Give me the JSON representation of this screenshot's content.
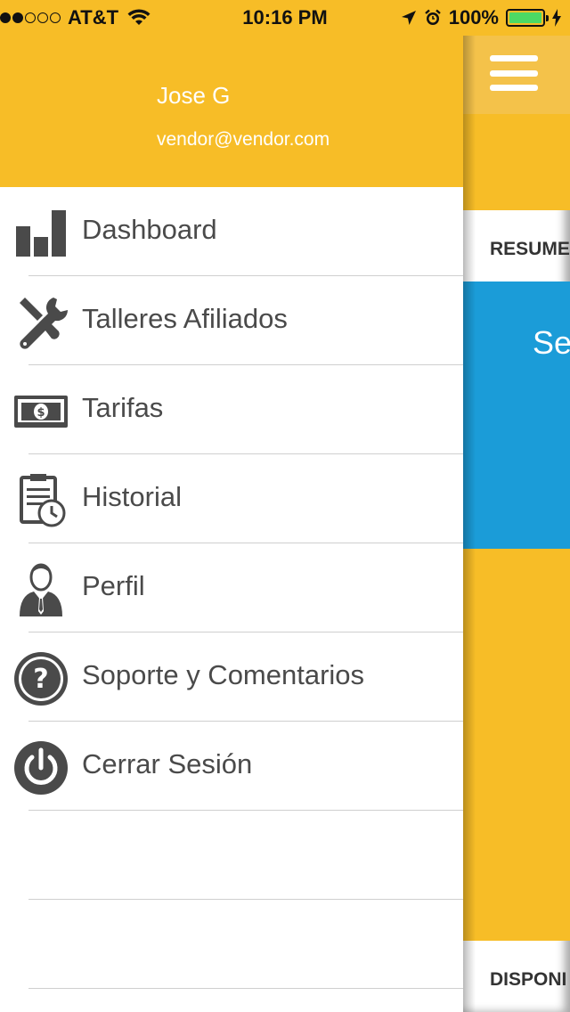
{
  "status_bar": {
    "carrier": "AT&T",
    "time": "10:16 PM",
    "battery": "100%",
    "signal_bars_filled": 2,
    "signal_bars_total": 5,
    "battery_level": 1.0
  },
  "drawer": {
    "user_name": "Jose G",
    "user_email": "vendor@vendor.com",
    "items": [
      {
        "label": "Dashboard",
        "icon": "bar-chart-icon"
      },
      {
        "label": "Talleres Afiliados",
        "icon": "tools-icon"
      },
      {
        "label": "Tarifas",
        "icon": "money-icon"
      },
      {
        "label": "Historial",
        "icon": "clipboard-clock-icon"
      },
      {
        "label": "Perfil",
        "icon": "person-icon"
      },
      {
        "label": "Soporte y Comentarios",
        "icon": "help-icon"
      },
      {
        "label": "Cerrar Sesión",
        "icon": "power-icon"
      }
    ]
  },
  "main": {
    "section_resumen": "RESUME",
    "blue_card_text": "Se",
    "section_disponible": "DISPONI"
  },
  "colors": {
    "accent_yellow": "#F7BD27",
    "accent_blue": "#1B9CD8",
    "icon_gray": "#4a4a4a"
  }
}
